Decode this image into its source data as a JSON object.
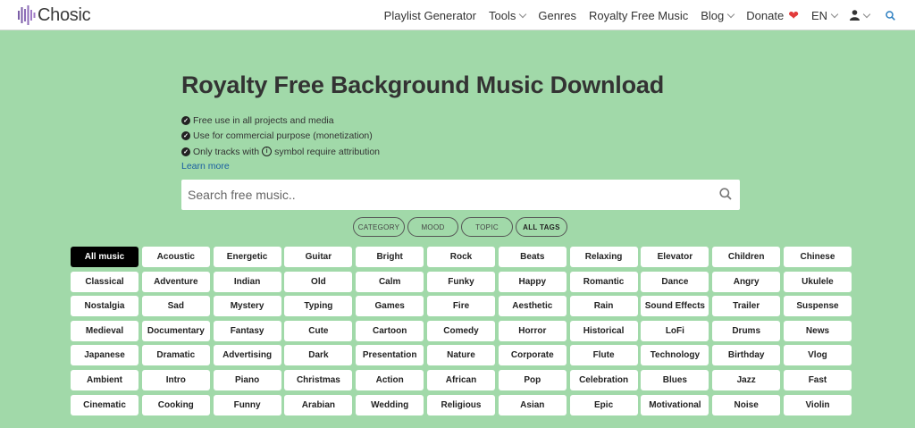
{
  "logo": {
    "text": "Chosic"
  },
  "nav": {
    "items": [
      {
        "label": "Playlist Generator",
        "dropdown": false
      },
      {
        "label": "Tools",
        "dropdown": true
      },
      {
        "label": "Genres",
        "dropdown": false
      },
      {
        "label": "Royalty Free Music",
        "dropdown": false
      },
      {
        "label": "Blog",
        "dropdown": true
      }
    ],
    "donate": {
      "label": "Donate",
      "icon": "heart-icon"
    },
    "language": {
      "label": "EN"
    }
  },
  "hero": {
    "title": "Royalty Free Background Music Download",
    "features": [
      "Free use in all projects and media",
      "Use for commercial purpose (monetization)"
    ],
    "attribution": {
      "before": "Only tracks with",
      "after": "symbol require attribution"
    },
    "learn_more": "Learn more"
  },
  "search": {
    "placeholder": "Search free music.."
  },
  "filters": [
    {
      "label": "CATEGORY",
      "active": false
    },
    {
      "label": "MOOD",
      "active": false
    },
    {
      "label": "TOPIC",
      "active": false
    },
    {
      "label": "ALL TAGS",
      "active": true
    }
  ],
  "tags": [
    "All music",
    "Acoustic",
    "Energetic",
    "Guitar",
    "Bright",
    "Rock",
    "Beats",
    "Relaxing",
    "Elevator",
    "Children",
    "Chinese",
    "Classical",
    "Adventure",
    "Indian",
    "Old",
    "Calm",
    "Funky",
    "Happy",
    "Romantic",
    "Dance",
    "Angry",
    "Ukulele",
    "Nostalgia",
    "Sad",
    "Mystery",
    "Typing",
    "Games",
    "Fire",
    "Aesthetic",
    "Rain",
    "Sound Effects",
    "Trailer",
    "Suspense",
    "Medieval",
    "Documentary",
    "Fantasy",
    "Cute",
    "Cartoon",
    "Comedy",
    "Horror",
    "Historical",
    "LoFi",
    "Drums",
    "News",
    "Japanese",
    "Dramatic",
    "Advertising",
    "Dark",
    "Presentation",
    "Nature",
    "Corporate",
    "Flute",
    "Technology",
    "Birthday",
    "Vlog",
    "Ambient",
    "Intro",
    "Piano",
    "Christmas",
    "Action",
    "African",
    "Pop",
    "Celebration",
    "Blues",
    "Jazz",
    "Fast",
    "Cinematic",
    "Cooking",
    "Funny",
    "Arabian",
    "Wedding",
    "Religious",
    "Asian",
    "Epic",
    "Motivational",
    "Noise",
    "Violin"
  ],
  "active_tag": "All music",
  "colors": {
    "background": "#a1d9a9",
    "link": "#1a5fa0",
    "accent": "#e23b3b"
  }
}
